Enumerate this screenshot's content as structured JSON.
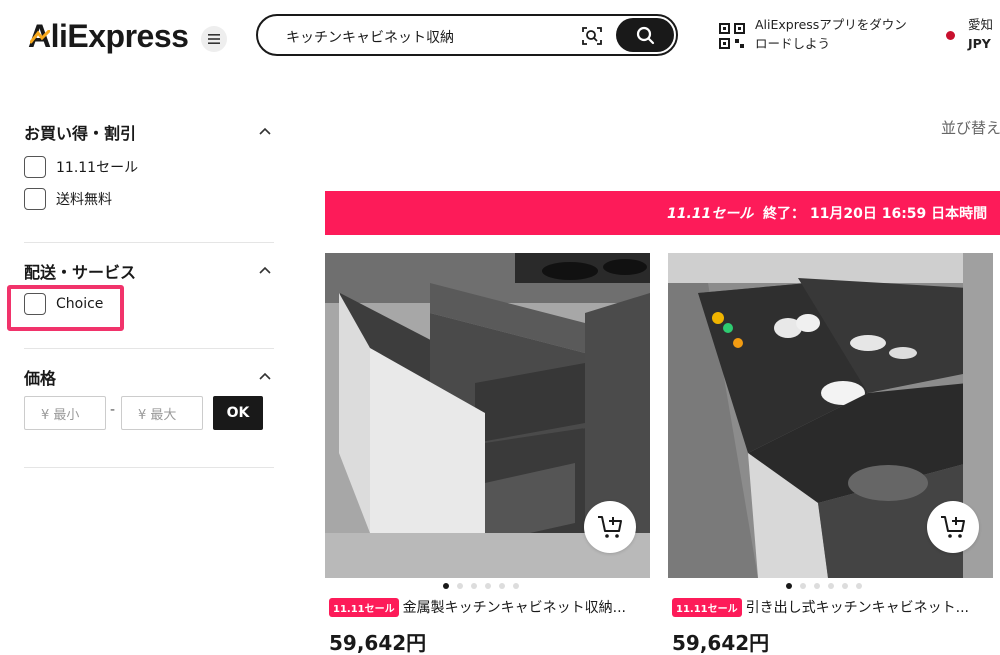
{
  "header": {
    "logo_text": "AliExpress",
    "search_value": "キッチンキャビネット収納",
    "app_promo_line1": "AliExpressアプリをダウン",
    "app_promo_line2": "ロードしよう",
    "region_line1": "愛知",
    "region_line2": "JPY"
  },
  "sidebar": {
    "deals": {
      "title": "お買い得・割引",
      "options": [
        "11.11セール",
        "送料無料"
      ]
    },
    "shipping": {
      "title": "配送・サービス",
      "options": [
        "Choice"
      ]
    },
    "price": {
      "title": "価格",
      "min_placeholder": "¥ 最小",
      "max_placeholder": "¥ 最大",
      "ok_label": "OK"
    }
  },
  "main": {
    "sort_label": "並び替え",
    "sale_banner": {
      "badge": "11.11セール",
      "text": "終了： 11月20日 16:59 日本時間"
    },
    "products": [
      {
        "badge": "11.11セール",
        "title": "金属製キッチンキャビネット収納...",
        "price": "59,642円",
        "dots": 6,
        "active_dot": 0
      },
      {
        "badge": "11.11セール",
        "title": "引き出し式キッチンキャビネット...",
        "price": "59,642円",
        "dots": 6,
        "active_dot": 0
      }
    ]
  },
  "colors": {
    "accent": "#fd1b59",
    "highlight": "#f1336b",
    "primary_dark": "#191919",
    "logo_orange": "#f7a81b"
  }
}
